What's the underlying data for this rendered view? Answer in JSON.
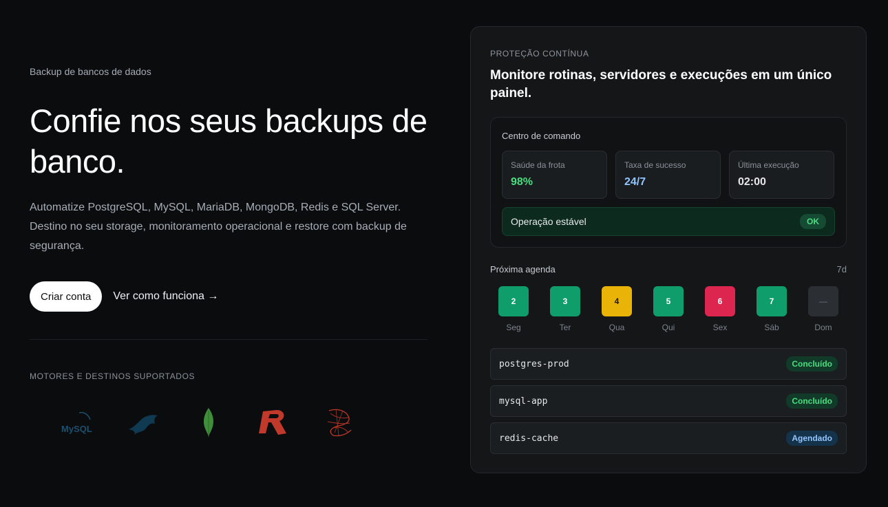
{
  "hero": {
    "eyebrow": "Backup de bancos de dados",
    "title": "Confie nos seus backups de banco.",
    "lead": "Automatize PostgreSQL, MySQL, MariaDB, MongoDB, Redis e SQL Server. Destino no seu storage, monitoramento operacional e restore com backup de segurança.",
    "primary_cta": "Criar conta",
    "secondary_cta": "Ver como funciona →"
  },
  "motors": {
    "label": "MOTORES E DESTINOS SUPORTADOS",
    "logos": [
      {
        "icon": "mysql-logo",
        "text": "MySQL"
      },
      {
        "icon": "mariadb-seal-logo"
      },
      {
        "icon": "mongodb-leaf-logo"
      },
      {
        "icon": "redis-logo"
      },
      {
        "icon": "sql-server-logo"
      }
    ]
  },
  "card": {
    "eyebrow": "PROTEÇÃO CONTÍNUA",
    "title": "Monitore rotinas, servidores e execuções em um único painel.",
    "command_center": {
      "label": "Centro de comando",
      "stats": [
        {
          "label": "Saúde da frota",
          "value": "98%",
          "color": "#4ade80"
        },
        {
          "label": "Taxa de sucesso",
          "value": "24/7",
          "color": "#93c5fd"
        },
        {
          "label": "Última execução",
          "value": "02:00",
          "color": "#e5e7eb"
        }
      ],
      "status": {
        "text": "Operação estável",
        "badge": "OK"
      }
    },
    "agenda": {
      "title": "Próxima agenda",
      "range": "7d",
      "days": [
        {
          "label": "Seg",
          "value": "2",
          "color": "#0f9d6b"
        },
        {
          "label": "Ter",
          "value": "3",
          "color": "#0f9d6b"
        },
        {
          "label": "Qua",
          "value": "4",
          "color": "#eab308"
        },
        {
          "label": "Qui",
          "value": "5",
          "color": "#0f9d6b"
        },
        {
          "label": "Sex",
          "value": "6",
          "color": "#dc2650"
        },
        {
          "label": "Sáb",
          "value": "7",
          "color": "#0f9d6b"
        },
        {
          "label": "Dom",
          "value": "—",
          "color": "#2b2e33"
        }
      ]
    },
    "jobs": [
      {
        "name": "postgres-prod",
        "status": "Concluído",
        "bg": "#113a28",
        "fg": "#4ade80"
      },
      {
        "name": "mysql-app",
        "status": "Concluído",
        "bg": "#113a28",
        "fg": "#4ade80"
      },
      {
        "name": "redis-cache",
        "status": "Agendado",
        "bg": "#14324a",
        "fg": "#93c5fd"
      }
    ]
  }
}
